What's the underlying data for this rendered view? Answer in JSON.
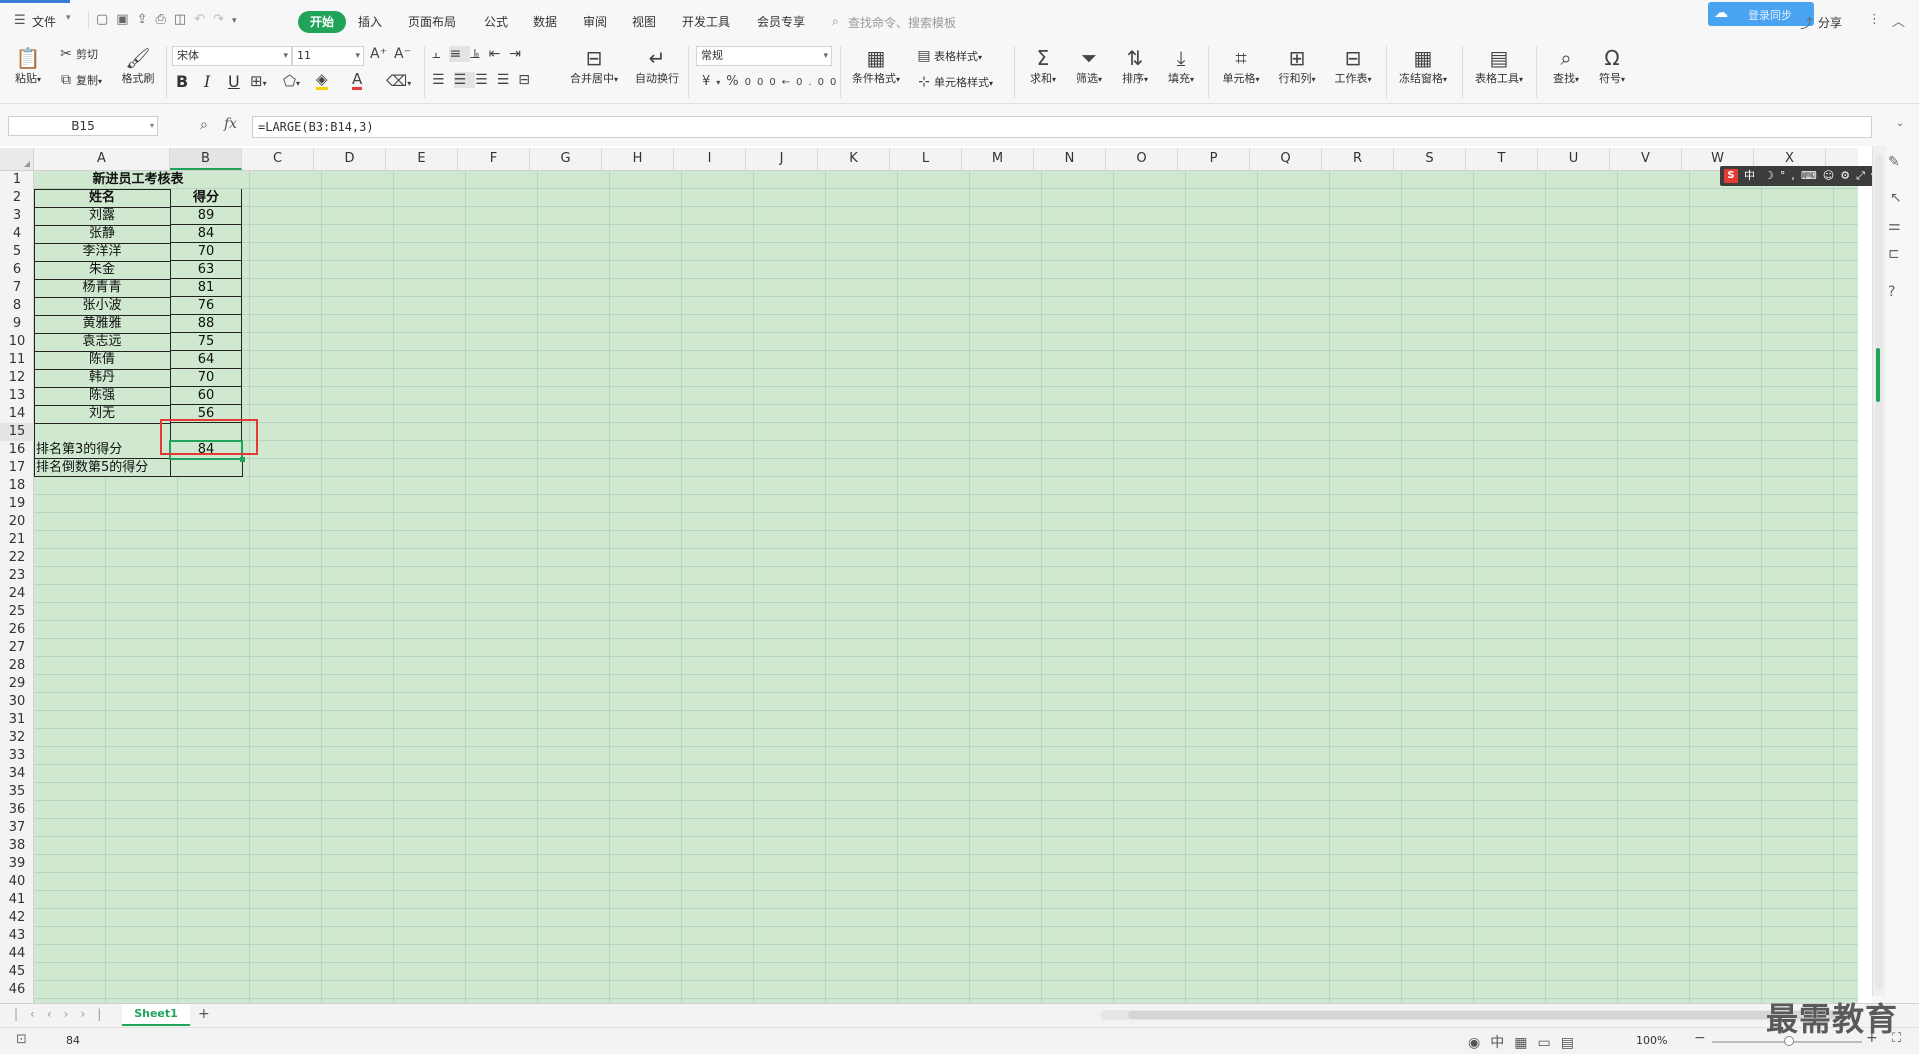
{
  "menubar": {
    "file_label": "文件",
    "tabs": [
      "开始",
      "插入",
      "页面布局",
      "公式",
      "数据",
      "审阅",
      "视图",
      "开发工具",
      "会员专享"
    ],
    "active_tab": "开始",
    "search_placeholder": "查找命令、搜索模板",
    "share_label": "分享",
    "cloud_label": "登录同步"
  },
  "ribbon": {
    "paste": "粘贴",
    "cut": "剪切",
    "copy": "复制",
    "format_painter": "格式刷",
    "font_name": "宋体",
    "font_size": "11",
    "merge_center": "合并居中",
    "wrap_text": "自动换行",
    "number_format": "常规",
    "conditional_format": "条件格式",
    "table_style": "表格样式",
    "cell_style": "单元格样式",
    "sum": "求和",
    "filter": "筛选",
    "sort": "排序",
    "fill": "填充",
    "cell": "单元格",
    "row_col": "行和列",
    "worksheet": "工作表",
    "freeze": "冻结窗格",
    "table_tools": "表格工具",
    "find": "查找",
    "symbol": "符号"
  },
  "formula_bar": {
    "name_box": "B15",
    "fx": "fx",
    "formula": "=LARGE(B3:B14,3)"
  },
  "columns": [
    "A",
    "B",
    "C",
    "D",
    "E",
    "F",
    "G",
    "H",
    "I",
    "J",
    "K",
    "L",
    "M",
    "N",
    "O",
    "P",
    "Q",
    "R",
    "S",
    "T",
    "U",
    "V",
    "W",
    "X"
  ],
  "rows": [
    "1",
    "2",
    "3",
    "4",
    "5",
    "6",
    "7",
    "8",
    "9",
    "10",
    "11",
    "12",
    "13",
    "14",
    "15",
    "16",
    "17",
    "18",
    "19",
    "20",
    "21",
    "22",
    "23",
    "24",
    "25",
    "26",
    "27",
    "28",
    "29",
    "30",
    "31",
    "32",
    "33",
    "34",
    "35",
    "36",
    "37",
    "38",
    "39",
    "40",
    "41",
    "42",
    "43",
    "44",
    "45",
    "46"
  ],
  "sheet": {
    "title": "新进员工考核表",
    "header_name": "姓名",
    "header_score": "得分",
    "employees": [
      {
        "name": "刘露",
        "score": "89"
      },
      {
        "name": "张静",
        "score": "84"
      },
      {
        "name": "李洋洋",
        "score": "70"
      },
      {
        "name": "朱金",
        "score": "63"
      },
      {
        "name": "杨青青",
        "score": "81"
      },
      {
        "name": "张小波",
        "score": "76"
      },
      {
        "name": "黄雅雅",
        "score": "88"
      },
      {
        "name": "袁志远",
        "score": "75"
      },
      {
        "name": "陈倩",
        "score": "64"
      },
      {
        "name": "韩丹",
        "score": "70"
      },
      {
        "name": "陈强",
        "score": "60"
      },
      {
        "name": "刘无",
        "score": "56"
      }
    ],
    "rank3_label": "排名第3的得分",
    "rank3_value": "84",
    "rank_last5_label": "排名倒数第5的得分",
    "rank_last5_value": ""
  },
  "ime_bar": {
    "lang": "中"
  },
  "sheet_tabs": {
    "active": "Sheet1",
    "add": "+"
  },
  "status": {
    "value": "84",
    "zoom": "100%"
  },
  "watermark": "最需教育",
  "colors": {
    "accent": "#22a35a",
    "grid_bg": "#cfe8cf",
    "highlight": "#e53935"
  }
}
